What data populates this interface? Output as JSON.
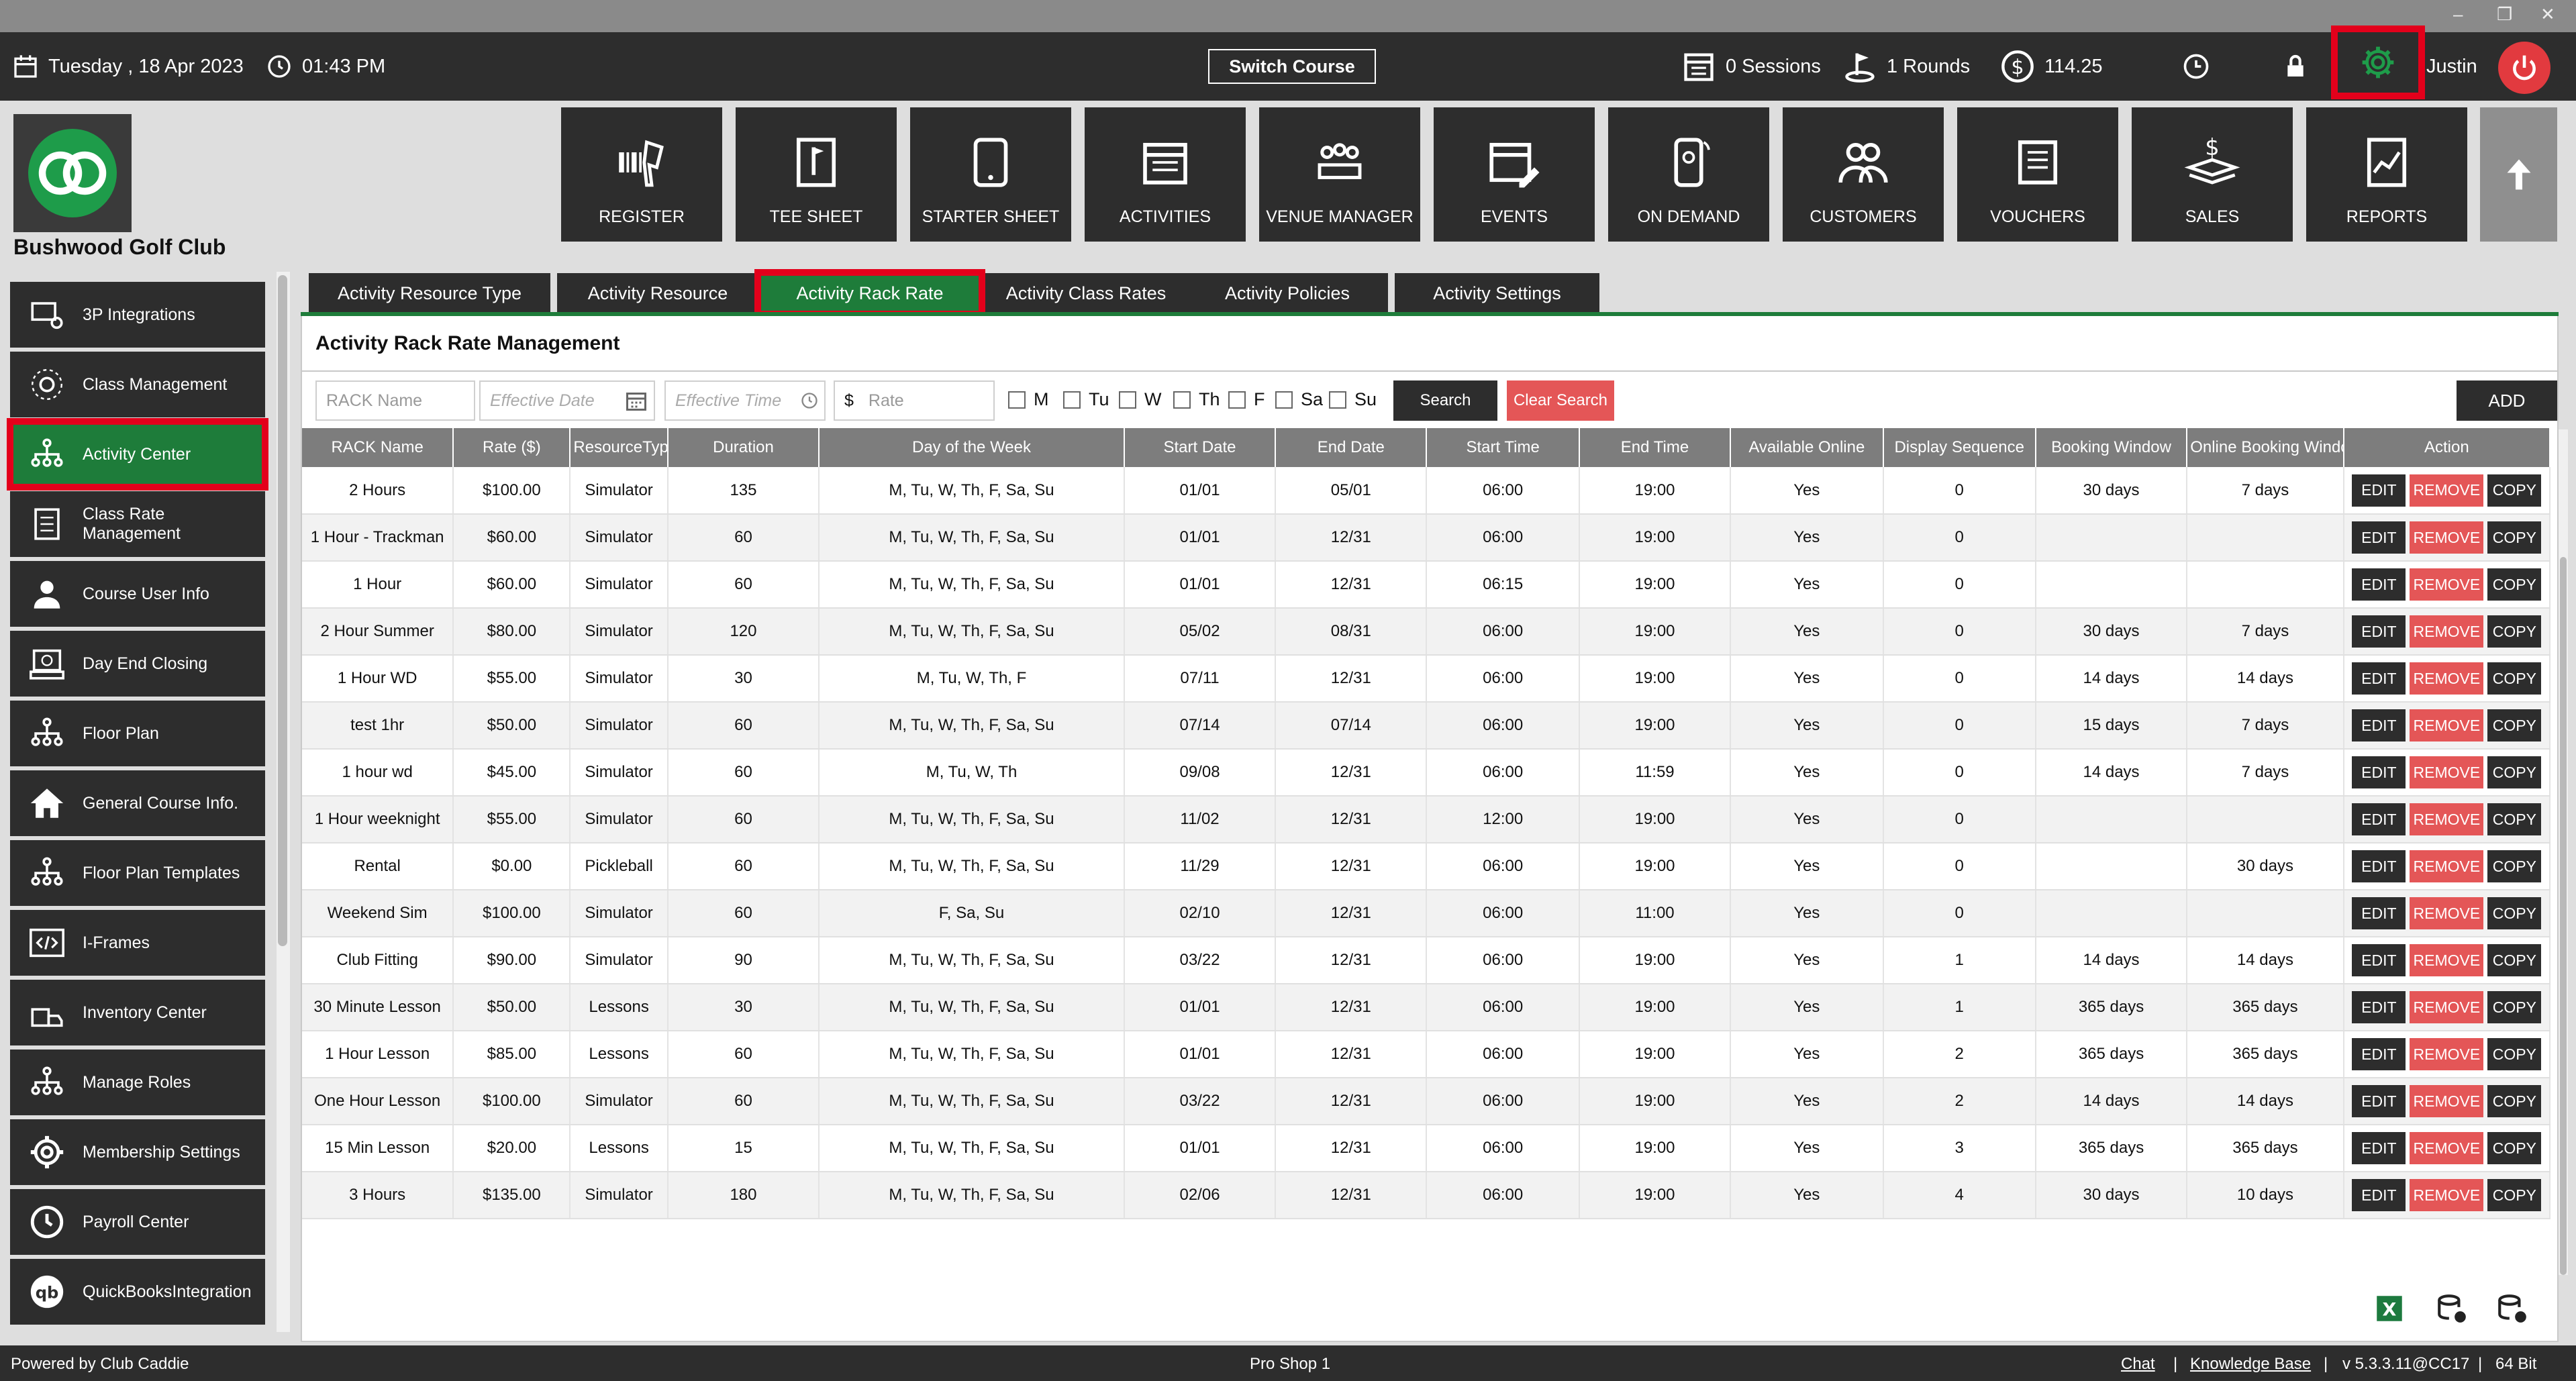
{
  "topbar": {
    "date": "Tuesday ,  18 Apr 2023",
    "time": "01:43 PM",
    "switch_course": "Switch Course",
    "sessions": "0 Sessions",
    "rounds": "1 Rounds",
    "balance": "114.25",
    "user": "Justin"
  },
  "club_name": "Bushwood Golf Club",
  "nav": [
    "REGISTER",
    "TEE SHEET",
    "STARTER SHEET",
    "ACTIVITIES",
    "VENUE MANAGER",
    "EVENTS",
    "ON DEMAND",
    "CUSTOMERS",
    "VOUCHERS",
    "SALES",
    "REPORTS"
  ],
  "sidebar": [
    {
      "label": "3P Integrations",
      "icon": "integrations-icon"
    },
    {
      "label": "Class Management",
      "icon": "class-management-icon"
    },
    {
      "label": "Activity  Center",
      "icon": "org-chart-icon"
    },
    {
      "label": "Class Rate Management",
      "icon": "checklist-icon"
    },
    {
      "label": "Course User Info",
      "icon": "user-icon"
    },
    {
      "label": "Day End Closing",
      "icon": "register-close-icon"
    },
    {
      "label": "Floor Plan",
      "icon": "org-chart-icon"
    },
    {
      "label": "General Course Info.",
      "icon": "home-icon"
    },
    {
      "label": "Floor Plan Templates",
      "icon": "org-chart-icon"
    },
    {
      "label": "I-Frames",
      "icon": "code-icon"
    },
    {
      "label": "Inventory Center",
      "icon": "inventory-icon"
    },
    {
      "label": "Manage Roles",
      "icon": "org-chart-icon"
    },
    {
      "label": "Membership Settings",
      "icon": "gear-icon"
    },
    {
      "label": "Payroll Center",
      "icon": "clock-icon"
    },
    {
      "label": "QuickBooksIntegration",
      "icon": "quickbooks-icon"
    }
  ],
  "tabs": [
    "Activity Resource Type",
    "Activity Resource",
    "Activity Rack Rate",
    "Activity Class Rates",
    "Activity Policies",
    "Activity Settings"
  ],
  "panel_title": "Activity Rack Rate Management",
  "filters": {
    "rack_name_placeholder": "RACK Name",
    "effective_date_placeholder": "Effective Date",
    "effective_time_placeholder": "Effective Time",
    "rate_prefix": "$",
    "rate_placeholder": "Rate",
    "days": [
      "M",
      "Tu",
      "W",
      "Th",
      "F",
      "Sa",
      "Su"
    ],
    "search": "Search",
    "clear_search": "Clear Search",
    "add": "ADD"
  },
  "table": {
    "headers": [
      "RACK Name",
      "Rate ($)",
      "ResourceType",
      "Duration",
      "Day of the Week",
      "Start Date",
      "End Date",
      "Start Time",
      "End Time",
      "Available Online",
      "Display Sequence",
      "Booking Window",
      "Online Booking Window",
      "Action"
    ],
    "actions": {
      "edit": "EDIT",
      "remove": "REMOVE",
      "copy": "COPY"
    },
    "rows": [
      [
        "2 Hours",
        "$100.00",
        "Simulator",
        "135",
        "M, Tu, W, Th, F, Sa, Su",
        "01/01",
        "05/01",
        "06:00",
        "19:00",
        "Yes",
        "0",
        "30 days",
        "7 days"
      ],
      [
        "1 Hour - Trackman",
        "$60.00",
        "Simulator",
        "60",
        "M, Tu, W, Th, F, Sa, Su",
        "01/01",
        "12/31",
        "06:00",
        "19:00",
        "Yes",
        "0",
        "",
        ""
      ],
      [
        "1 Hour",
        "$60.00",
        "Simulator",
        "60",
        "M, Tu, W, Th, F, Sa, Su",
        "01/01",
        "12/31",
        "06:15",
        "19:00",
        "Yes",
        "0",
        "",
        ""
      ],
      [
        "2 Hour Summer",
        "$80.00",
        "Simulator",
        "120",
        "M, Tu, W, Th, F, Sa, Su",
        "05/02",
        "08/31",
        "06:00",
        "19:00",
        "Yes",
        "0",
        "30 days",
        "7 days"
      ],
      [
        "1 Hour WD",
        "$55.00",
        "Simulator",
        "30",
        "M, Tu, W, Th, F",
        "07/11",
        "12/31",
        "06:00",
        "19:00",
        "Yes",
        "0",
        "14 days",
        "14 days"
      ],
      [
        "test 1hr",
        "$50.00",
        "Simulator",
        "60",
        "M, Tu, W, Th, F, Sa, Su",
        "07/14",
        "07/14",
        "06:00",
        "19:00",
        "Yes",
        "0",
        "15 days",
        "7 days"
      ],
      [
        "1 hour wd",
        "$45.00",
        "Simulator",
        "60",
        "M, Tu, W, Th",
        "09/08",
        "12/31",
        "06:00",
        "11:59",
        "Yes",
        "0",
        "14 days",
        "7 days"
      ],
      [
        "1 Hour weeknight",
        "$55.00",
        "Simulator",
        "60",
        "M, Tu, W, Th, F, Sa, Su",
        "11/02",
        "12/31",
        "12:00",
        "19:00",
        "Yes",
        "0",
        "",
        ""
      ],
      [
        "Rental",
        "$0.00",
        "Pickleball",
        "60",
        "M, Tu, W, Th, F, Sa, Su",
        "11/29",
        "12/31",
        "06:00",
        "19:00",
        "Yes",
        "0",
        "",
        "30 days"
      ],
      [
        "Weekend Sim",
        "$100.00",
        "Simulator",
        "60",
        "F, Sa, Su",
        "02/10",
        "12/31",
        "06:00",
        "11:00",
        "Yes",
        "0",
        "",
        ""
      ],
      [
        "Club Fitting",
        "$90.00",
        "Simulator",
        "90",
        "M, Tu, W, Th, F, Sa, Su",
        "03/22",
        "12/31",
        "06:00",
        "19:00",
        "Yes",
        "1",
        "14 days",
        "14 days"
      ],
      [
        "30 Minute Lesson",
        "$50.00",
        "Lessons",
        "30",
        "M, Tu, W, Th, F, Sa, Su",
        "01/01",
        "12/31",
        "06:00",
        "19:00",
        "Yes",
        "1",
        "365 days",
        "365 days"
      ],
      [
        "1 Hour Lesson",
        "$85.00",
        "Lessons",
        "60",
        "M, Tu, W, Th, F, Sa, Su",
        "01/01",
        "12/31",
        "06:00",
        "19:00",
        "Yes",
        "2",
        "365 days",
        "365 days"
      ],
      [
        "One Hour Lesson",
        "$100.00",
        "Simulator",
        "60",
        "M, Tu, W, Th, F, Sa, Su",
        "03/22",
        "12/31",
        "06:00",
        "19:00",
        "Yes",
        "2",
        "14 days",
        "14 days"
      ],
      [
        "15 Min Lesson",
        "$20.00",
        "Lessons",
        "15",
        "M, Tu, W, Th, F, Sa, Su",
        "01/01",
        "12/31",
        "06:00",
        "19:00",
        "Yes",
        "3",
        "365 days",
        "365 days"
      ],
      [
        "3 Hours",
        "$135.00",
        "Simulator",
        "180",
        "M, Tu, W, Th, F, Sa, Su",
        "02/06",
        "12/31",
        "06:00",
        "19:00",
        "Yes",
        "4",
        "30 days",
        "10 days"
      ]
    ]
  },
  "statusbar": {
    "powered_by": "Powered by Club Caddie",
    "center": "Pro Shop 1",
    "chat": "Chat",
    "knowledge_base": "Knowledge Base",
    "version": "v 5.3.3.11@CC17",
    "bits": "64 Bit"
  },
  "colors": {
    "accent": "#1e7c3a",
    "highlight": "#e3001b",
    "danger": "#e45657",
    "dark": "#2d2d2d"
  }
}
